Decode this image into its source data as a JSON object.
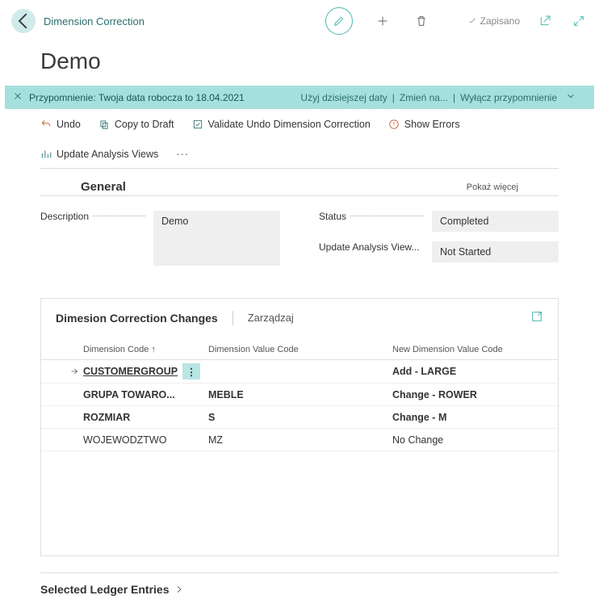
{
  "breadcrumb": "Dimension Correction",
  "page_title": "Demo",
  "saved_label": "Zapisano",
  "reminder": {
    "message": "Przypomnienie: Twoja data robocza to 18.04.2021",
    "link_today": "Użyj dzisiejszej daty",
    "link_change": "Zmień na...",
    "link_off": "Wyłącz przypomnienie"
  },
  "actions": {
    "undo": "Undo",
    "copy_draft": "Copy to Draft",
    "validate": "Validate Undo Dimension Correction",
    "show_errors": "Show Errors",
    "update_views": "Update Analysis Views"
  },
  "general": {
    "section_title": "General",
    "show_more": "Pokaż więcej",
    "description_label": "Description",
    "description_value": "Demo",
    "status_label": "Status",
    "status_value": "Completed",
    "update_label": "Update Analysis View...",
    "update_value": "Not Started"
  },
  "changes": {
    "title": "Dimesion Correction Changes",
    "manage": "Zarządzaj",
    "cols": {
      "dim_code": "Dimension Code ↑",
      "val_code": "Dimension Value Code",
      "new_val": "New Dimension Value Code"
    },
    "rows": [
      {
        "code": "CUSTOMERGROUP",
        "val": "",
        "new_val": "Add - LARGE",
        "selected": true,
        "bold": true
      },
      {
        "code": "GRUPA TOWARO...",
        "val": "MEBLE",
        "new_val": "Change - ROWER",
        "selected": false,
        "bold": true
      },
      {
        "code": "ROZMIAR",
        "val": "S",
        "new_val": "Change - M",
        "selected": false,
        "bold": true
      },
      {
        "code": "WOJEWODZTWO",
        "val": "MZ",
        "new_val": "No Change",
        "selected": false,
        "bold": false
      }
    ]
  },
  "ledger_title": "Selected Ledger Entries"
}
